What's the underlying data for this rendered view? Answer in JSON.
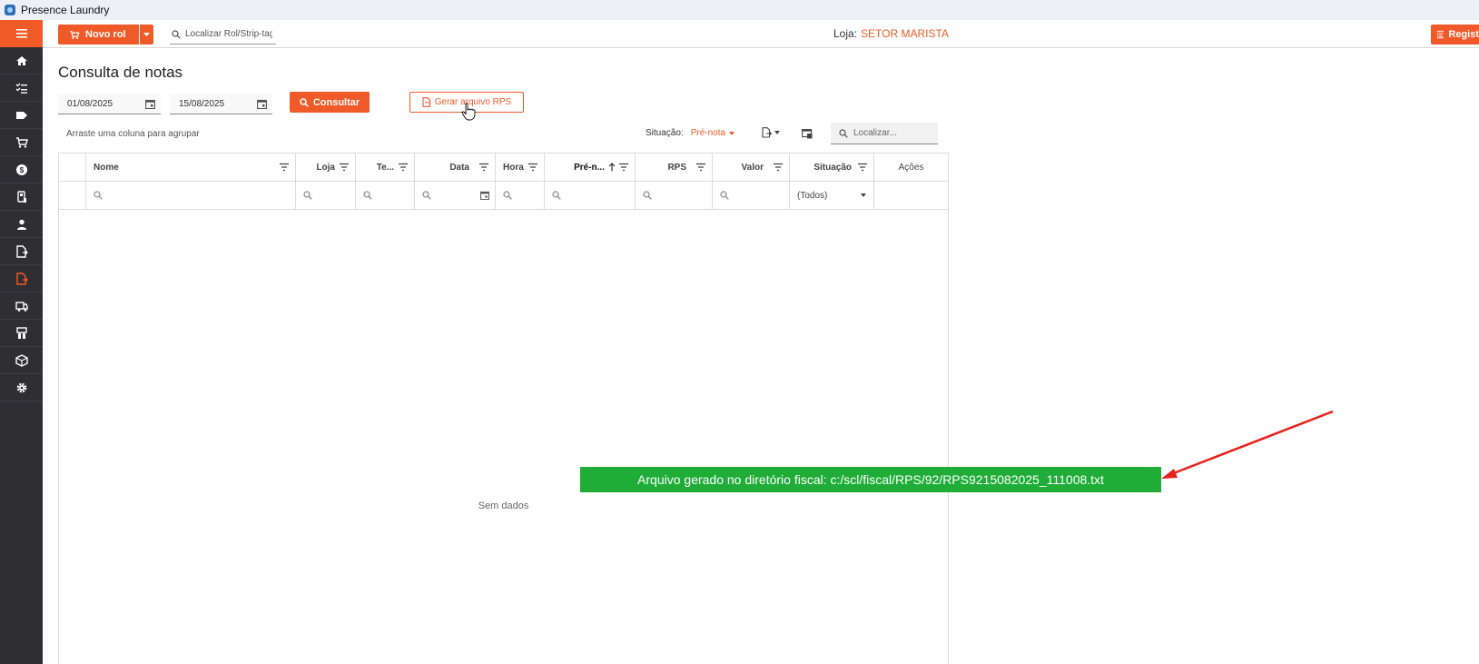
{
  "window": {
    "title": "Presence Laundry"
  },
  "topbar": {
    "novo_rol": "Novo rol",
    "search_placeholder": "Localizar Rol/Strip-tag",
    "loja_label": "Loja:",
    "loja_value": "SETOR MARISTA",
    "regist_label": "Regist"
  },
  "sidebar": {
    "icons": [
      "home-icon",
      "checklist-icon",
      "tag-icon",
      "cart-icon",
      "money-icon",
      "machine-icon",
      "person-icon",
      "document-icon",
      "document-active-icon",
      "truck-icon",
      "building-icon",
      "box-icon",
      "gear-icon"
    ]
  },
  "page": {
    "title": "Consulta de notas",
    "date_from": "01/08/2025",
    "date_to": "15/08/2025",
    "consultar": "Consultar",
    "gerar_rps": "Gerar arquivo RPS",
    "group_hint": "Arraste uma coluna para agrupar",
    "situacao_label": "Situação:",
    "situacao_value": "Pré-nota",
    "localizar_placeholder": "Localizar..."
  },
  "grid": {
    "columns": [
      "Nome",
      "Loja",
      "Te...",
      "Data",
      "Hora",
      "Pré-n...",
      "RPS",
      "Valor",
      "Situação",
      "Ações"
    ],
    "situacao_filter": "(Todos)",
    "empty_text": "Sem dados"
  },
  "toast": {
    "message": "Arquivo gerado no diretório fiscal: c:/scl/fiscal/RPS/92/RPS9215082025_111008.txt"
  },
  "colors": {
    "accent": "#f05a28",
    "sidebar": "#2e2e33",
    "toast": "#1fad37"
  }
}
